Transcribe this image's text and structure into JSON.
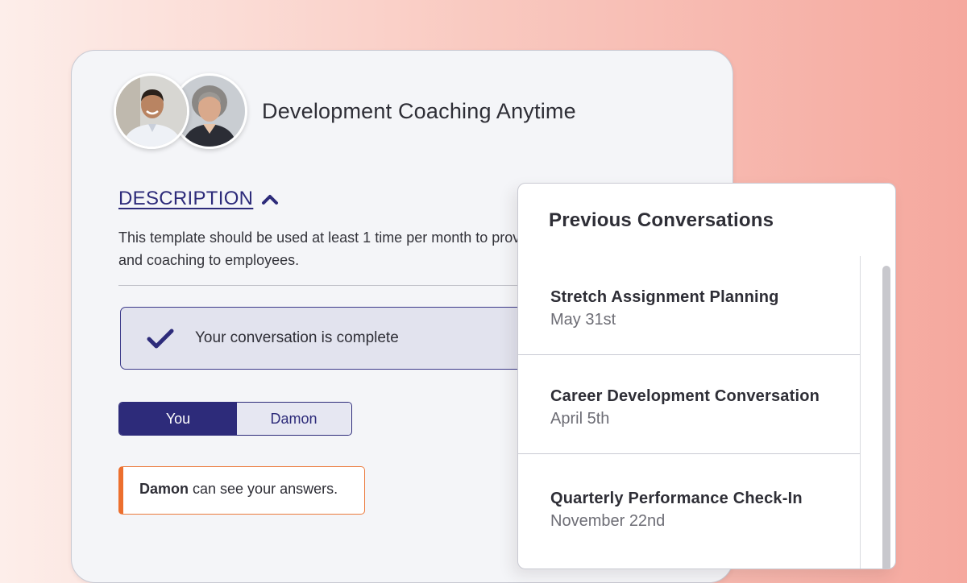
{
  "card": {
    "title": "Development Coaching Anytime",
    "avatars": [
      {
        "name": "employee-avatar",
        "icon": "person-photo"
      },
      {
        "name": "manager-avatar",
        "icon": "person-photo"
      }
    ],
    "description": {
      "heading": "DESCRIPTION",
      "toggle_icon": "chevron-up-icon",
      "text": "This template should be used at least 1 time per month to provide development and coaching to employees."
    },
    "status": {
      "icon": "check-icon",
      "text": "Your conversation is complete"
    },
    "view_toggle": {
      "options": [
        "You",
        "Damon"
      ],
      "selected": "You"
    },
    "visibility_note": {
      "name": "Damon",
      "text": " can see your answers."
    }
  },
  "previous_conversations": {
    "title": "Previous Conversations",
    "items": [
      {
        "title": "Stretch Assignment Planning",
        "date": "May 31st"
      },
      {
        "title": "Career Development Conversation",
        "date": "April 5th"
      },
      {
        "title": "Quarterly Performance Check-In",
        "date": "November 22nd"
      }
    ]
  },
  "colors": {
    "accent": "#2d2b7a",
    "warning_border": "#ec6f2e",
    "background_gradient_end": "#f5a89e"
  }
}
